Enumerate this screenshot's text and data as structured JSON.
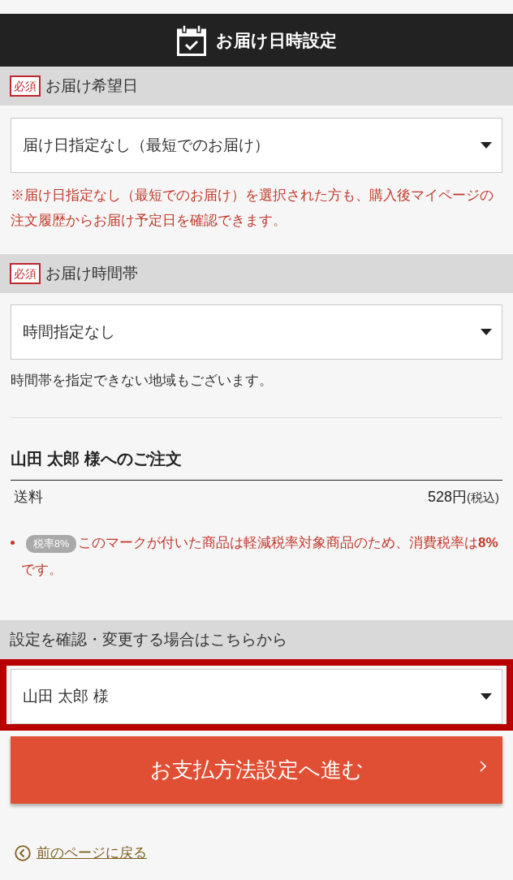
{
  "header": {
    "title": "お届け日時設定"
  },
  "delivery_date": {
    "required_badge": "必須",
    "label": "お届け希望日",
    "select": {
      "value": "届け日指定なし（最短でのお届け）"
    },
    "note": "※届け日指定なし（最短でのお届け）を選択された方も、購入後マイページの注文履歴からお届け予定日を確認できます。"
  },
  "delivery_time": {
    "required_badge": "必須",
    "label": "お届け時間帯",
    "select": {
      "value": "時間指定なし"
    },
    "note": "時間帯を指定できない地域もございます。"
  },
  "order": {
    "title": "山田 太郎 様へのご注文",
    "shipping": {
      "label": "送料",
      "amount": "528円",
      "tax_note": "(税込)"
    },
    "notes": [
      {
        "badge": "税率8%",
        "text": "このマークが付いた商品は軽減税率対象商品のため、消費税率は**8%**です。"
      }
    ]
  },
  "recipient": {
    "label": "設定を確認・変更する場合はこちらから",
    "select": {
      "value": "山田 太郎 様",
      "highlighted": true
    }
  },
  "next_button": {
    "label": "お支払方法設定へ進む"
  },
  "back_link": {
    "label": "前のページに戻る"
  }
}
